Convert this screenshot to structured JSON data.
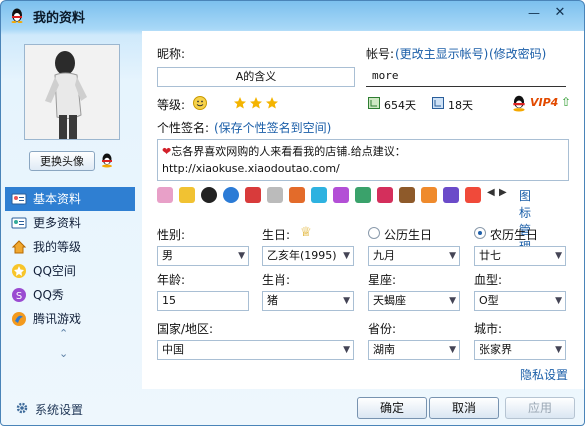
{
  "window": {
    "title": "我的资料"
  },
  "left": {
    "change_avatar": "更换头像",
    "nav": [
      {
        "label": "基本资料",
        "icon": "profile-card-icon",
        "active": true
      },
      {
        "label": "更多资料",
        "icon": "more-info-icon"
      },
      {
        "label": "我的等级",
        "icon": "level-house-icon"
      },
      {
        "label": "QQ空间",
        "icon": "qzone-star-icon"
      },
      {
        "label": "QQ秀",
        "icon": "qqshow-icon"
      },
      {
        "label": "腾讯游戏",
        "icon": "tencent-games-icon"
      }
    ]
  },
  "form": {
    "nickname_label": "昵称:",
    "nickname_value": "A的含义",
    "account_label": "帐号:",
    "change_main_account": "(更改主显示帐号)",
    "change_password": "(修改密码)",
    "account_value": "more",
    "level_label": "等级:",
    "days_online": "654天",
    "days_active": "18天",
    "vip": "VIP4",
    "signature_label": "个性签名:",
    "save_signature": "(保存个性签名到空间)",
    "signature_text": "忘各界喜欢网购的人来看看我的店铺.给点建议：http://xiaokuse.xiaodoutao.com/",
    "icon_manage": "图标管理",
    "gender_label": "性别:",
    "gender_value": "男",
    "birthday_label": "生日:",
    "birthday_value": "乙亥年(1995)",
    "calendar_solar": "公历生日",
    "calendar_lunar": "农历生日",
    "month_value": "九月",
    "day_value": "廿七",
    "age_label": "年龄:",
    "age_value": "15",
    "zodiac_label": "生肖:",
    "zodiac_value": "猪",
    "star_label": "星座:",
    "star_value": "天蝎座",
    "blood_label": "血型:",
    "blood_value": "O型",
    "country_label": "国家/地区:",
    "country_value": "中国",
    "province_label": "省份:",
    "province_value": "湖南",
    "city_label": "城市:",
    "city_value": "张家界",
    "privacy": "隐私设置"
  },
  "bottom": {
    "settings": "系统设置",
    "ok": "确定",
    "cancel": "取消",
    "apply": "应用"
  }
}
